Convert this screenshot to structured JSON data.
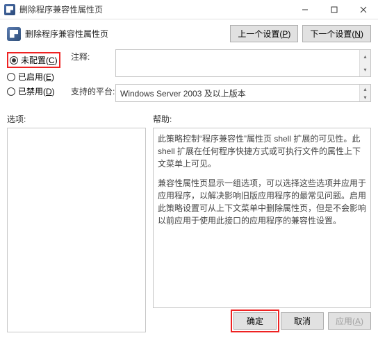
{
  "window": {
    "title": "删除程序兼容性属性页"
  },
  "heading": "删除程序兼容性属性页",
  "nav": {
    "prev_label": "上一个设置(",
    "prev_accel": "P",
    "prev_suffix": ")",
    "next_label": "下一个设置(",
    "next_accel": "N",
    "next_suffix": ")"
  },
  "radios": {
    "not_configured_label": "未配置(",
    "not_configured_accel": "C",
    "not_configured_suffix": ")",
    "enabled_label": "已启用(",
    "enabled_accel": "E",
    "enabled_suffix": ")",
    "disabled_label": "已禁用(",
    "disabled_accel": "D",
    "disabled_suffix": ")"
  },
  "fields": {
    "comment_label": "注释:",
    "platform_label": "支持的平台:",
    "platform_value": "Windows Server 2003 及以上版本"
  },
  "options_label": "选项:",
  "help_label": "帮助:",
  "help": {
    "p1": "此策略控制“程序兼容性”属性页 shell 扩展的可见性。此 shell 扩展在任何程序快捷方式或可执行文件的属性上下文菜单上可见。",
    "p2": "兼容性属性页显示一组选项，可以选择这些选项并应用于应用程序，以解决影响旧版应用程序的最常见问题。启用此策略设置可从上下文菜单中删除属性页，但是不会影响以前应用于使用此接口的应用程序的兼容性设置。"
  },
  "footer": {
    "ok_label": "确定",
    "cancel_label": "取消",
    "apply_label": "应用(",
    "apply_accel": "A",
    "apply_suffix": ")"
  }
}
